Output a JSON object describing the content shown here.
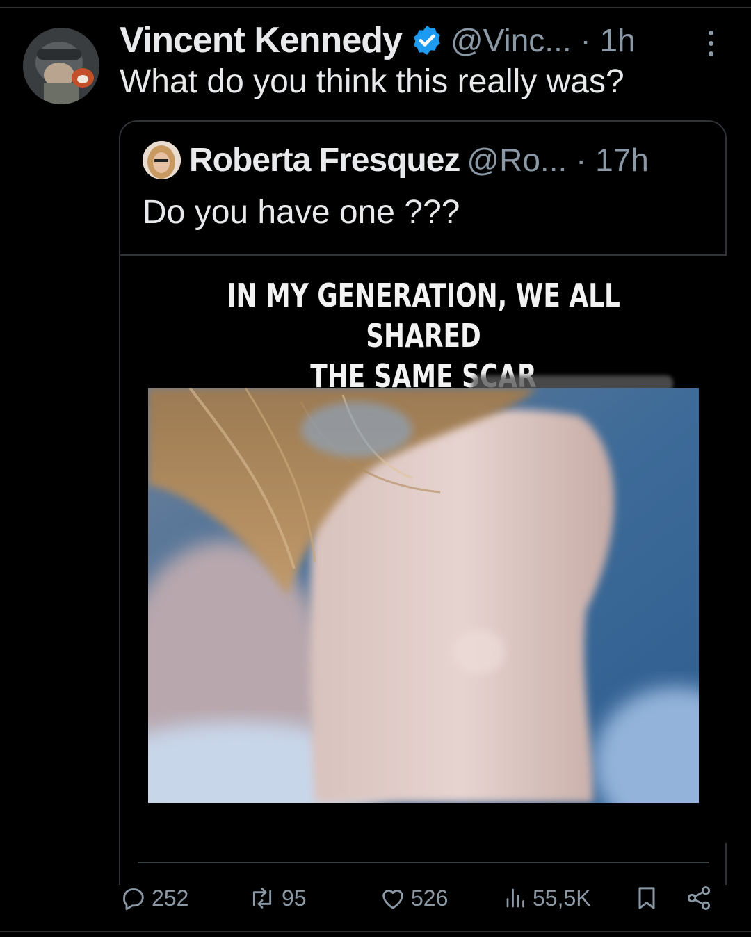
{
  "tweet": {
    "author_name": "Vincent Kennedy",
    "author_handle_time": "@Vinc... · 1h",
    "text": "What do you think this really was?"
  },
  "quoted": {
    "author_name": "Roberta Fresquez",
    "author_handle_time": "@Ro... · 17h",
    "text": "Do you have one ???",
    "meme_caption_line1": "IN MY GENERATION, WE ALL SHARED",
    "meme_caption_line2": "THE SAME SCAR"
  },
  "actions": {
    "replies": "252",
    "reposts": "95",
    "likes": "526",
    "views": "55,5K"
  },
  "colors": {
    "background": "#000000",
    "text": "#e7e9ea",
    "muted": "#8b98a5",
    "verified": "#1d9bf0",
    "border": "#2f3336"
  },
  "icons": [
    "verified-badge-icon",
    "more-icon",
    "reply-icon",
    "repost-icon",
    "like-icon",
    "views-icon",
    "bookmark-icon",
    "share-icon"
  ]
}
